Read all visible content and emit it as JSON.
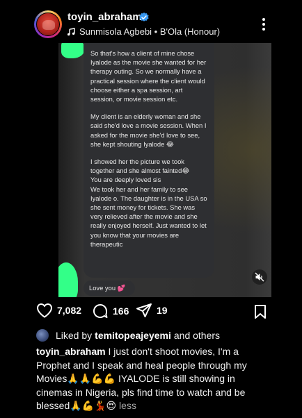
{
  "post": {
    "username": "toyin_abraham",
    "verified": true,
    "audio_label": "Sunmisola Agbebi • B'Ola (Honour)",
    "audio_icon": "music-note-icon"
  },
  "media": {
    "chat_paragraphs": [
      "So that's how a client of mine chose Iyalode as the movie she wanted for her therapy outing. So we normally have a practical session where the client would choose either a spa session, art session, or movie session etc.",
      "My client is an elderly woman and she said she'd love a movie session. When I asked for the movie she'd love to see, she kept shouting Iyalode 😂",
      "I showed her the picture we took together and she almost fainted😂"
    ],
    "chat_lines_after": [
      "You are deeply loved sis",
      "We took her and her family to see Iyalode o. The daughter is in the USA so she sent money for tickets. She was very relieved after the movie and she really enjoyed herself. Just wanted to let you know that your movies are therapeutic"
    ],
    "love_message": "Love you 💕",
    "mute_icon": "speaker-muted-icon"
  },
  "actions": {
    "likes": "7,082",
    "comments": "166",
    "shares": "19"
  },
  "likes_line": {
    "prefix": "Liked by",
    "user": "temitopeajeyemi",
    "suffix": "and others"
  },
  "caption": {
    "username": "toyin_abraham",
    "text": "I just don't shoot movies, I'm a Prophet and I speak and heal people through my Movies🙏🙏💪💪 IYALODE is still showing in cinemas in Nigeria, pls find time to watch and be blessed🙏💪💃😍",
    "less_label": "less"
  },
  "colors": {
    "background": "#000000",
    "verified_badge": "#3797f0",
    "chat_bubble": "#2e2f32",
    "highlight_green": "#33ff88"
  }
}
